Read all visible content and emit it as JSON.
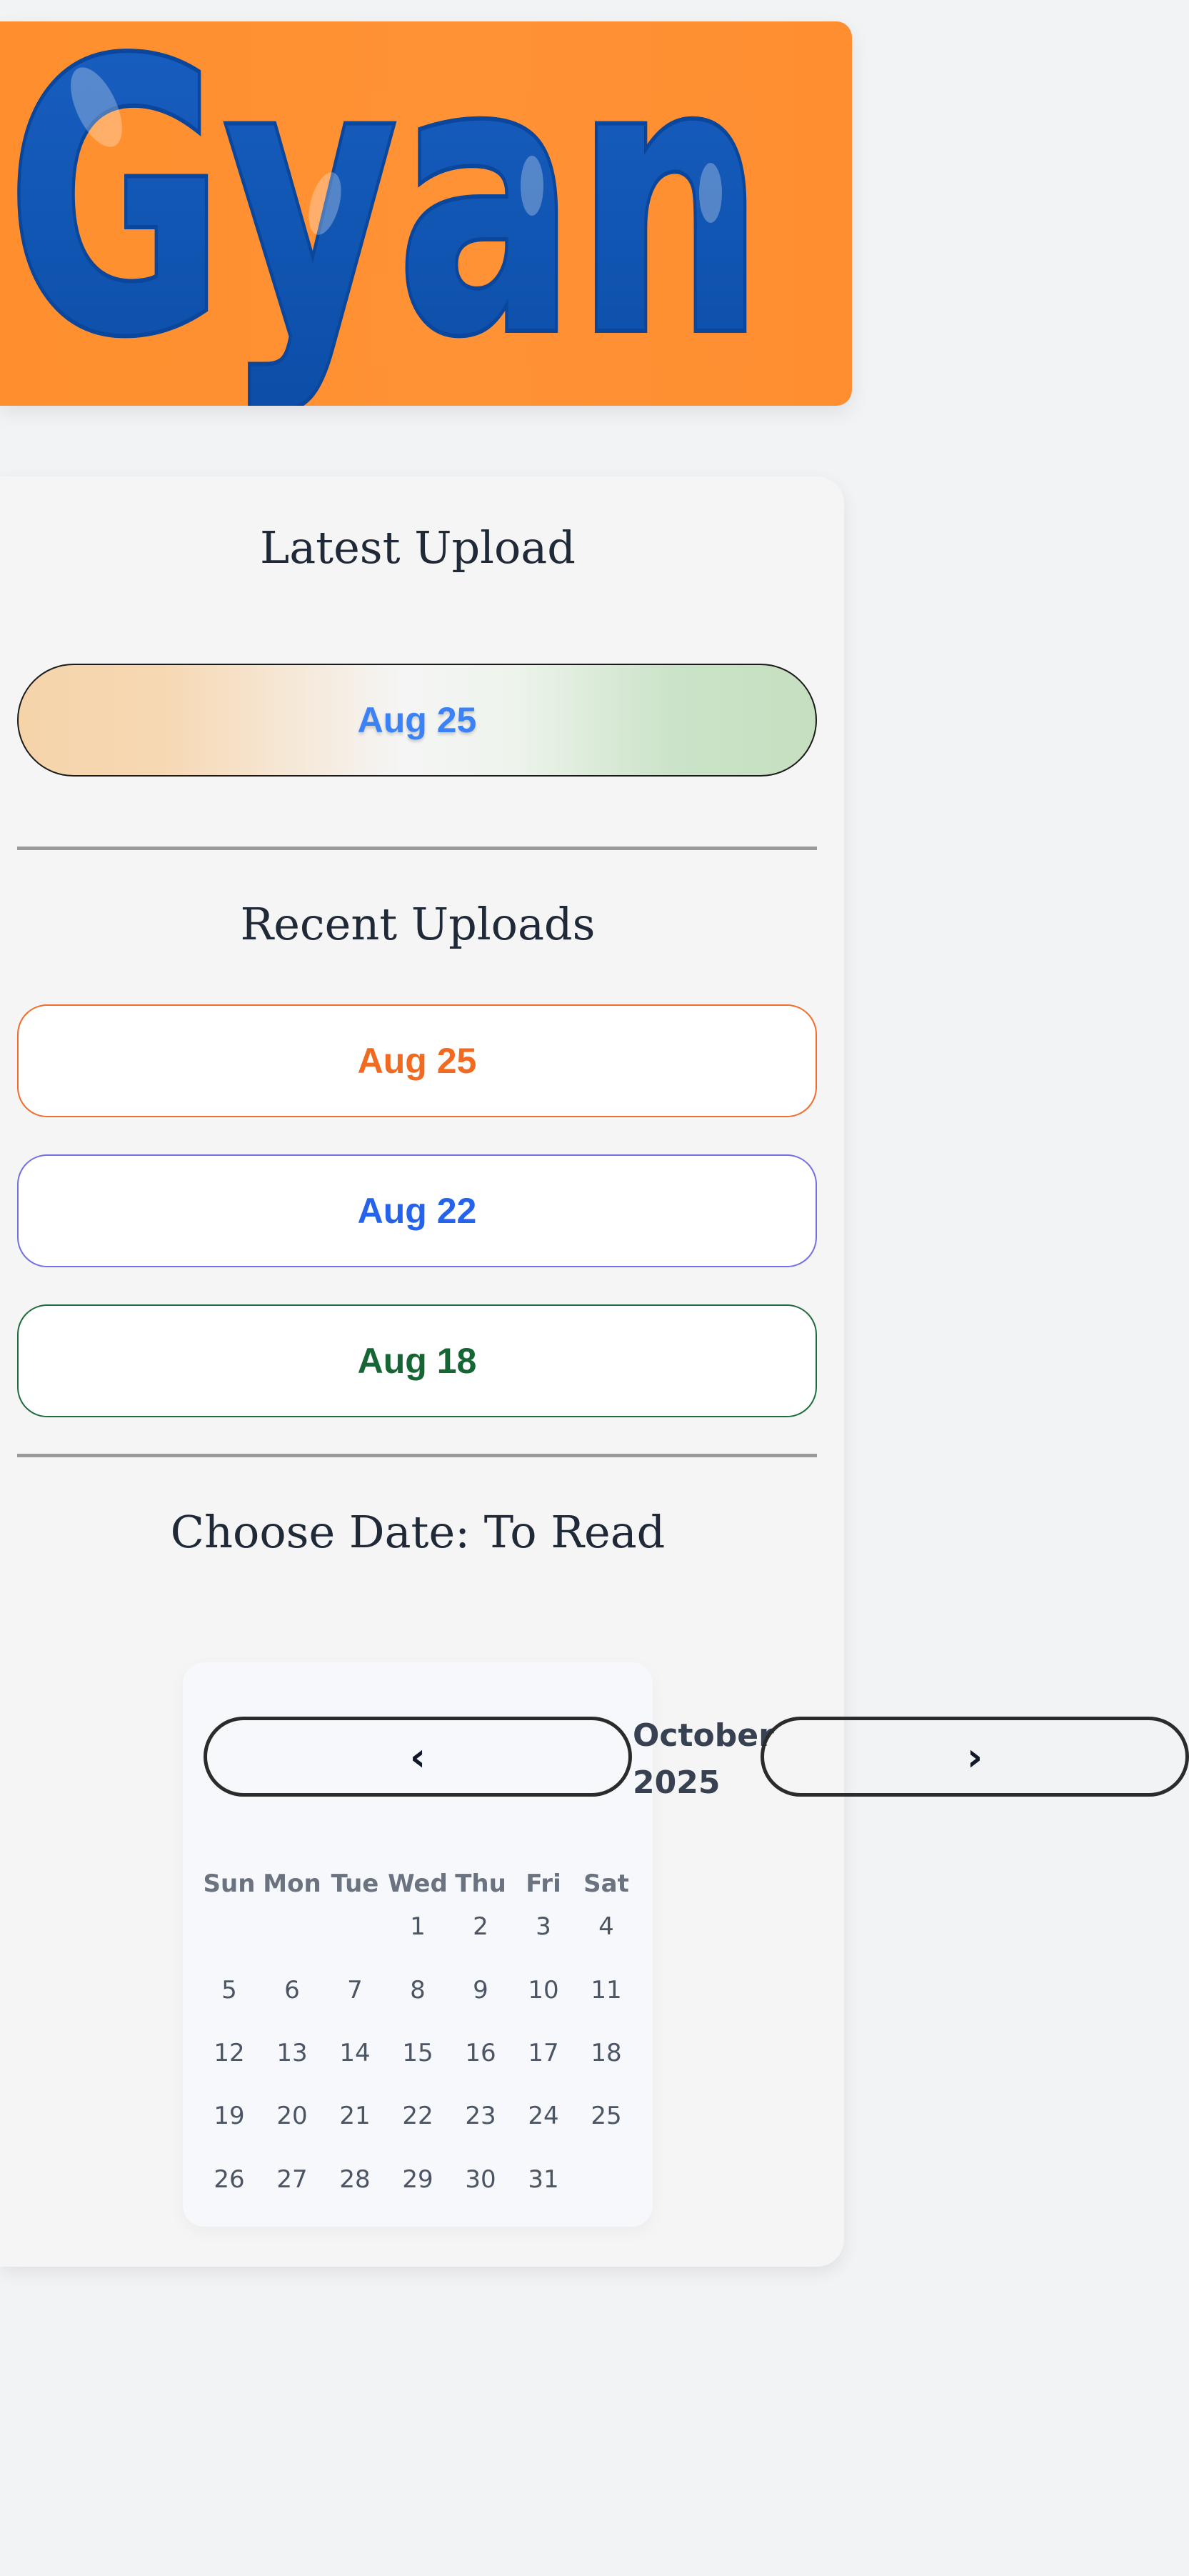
{
  "logo": {
    "text": "Gyan",
    "background_color": "#ff9233",
    "text_color": "#0f55b5"
  },
  "latest": {
    "title": "Latest Upload",
    "button_label": "Aug 25",
    "label_color": "#3b82f6"
  },
  "recent": {
    "title": "Recent Uploads",
    "items": [
      {
        "label": "Aug 25",
        "color": "#f06a21"
      },
      {
        "label": "Aug 22",
        "color": "#2563eb"
      },
      {
        "label": "Aug 18",
        "color": "#166534"
      }
    ]
  },
  "calendar": {
    "title": "Choose Date: To Read",
    "prev_label": "‹",
    "next_label": "›",
    "month_label": "October 2025",
    "weekdays": [
      "Sun",
      "Mon",
      "Tue",
      "Wed",
      "Thu",
      "Fri",
      "Sat"
    ],
    "days": [
      "1",
      "2",
      "3",
      "4",
      "5",
      "6",
      "7",
      "8",
      "9",
      "10",
      "11",
      "12",
      "13",
      "14",
      "15",
      "16",
      "17",
      "18",
      "19",
      "20",
      "21",
      "22",
      "23",
      "24",
      "25",
      "26",
      "27",
      "28",
      "29",
      "30",
      "31"
    ]
  }
}
